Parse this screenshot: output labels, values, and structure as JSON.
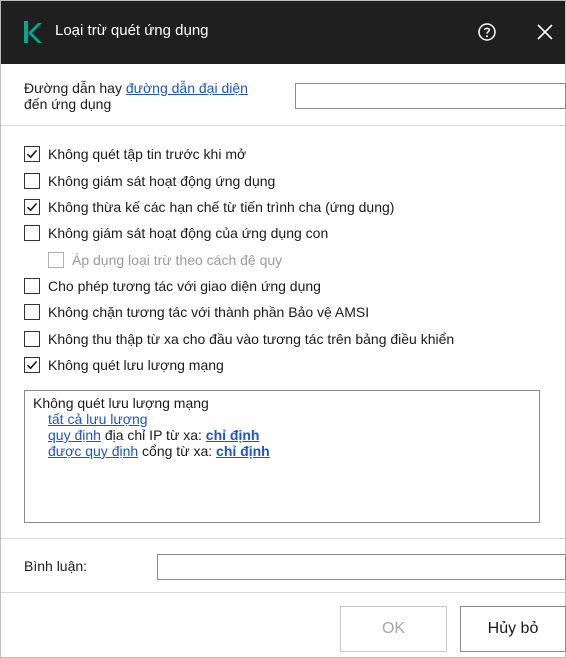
{
  "window": {
    "title": "Loại trừ quét ứng dụng"
  },
  "path": {
    "label_prefix": "Đường dẫn hay ",
    "label_link": "đường dẫn đại diện",
    "label_suffix": "đến ứng dụng",
    "value": ""
  },
  "options": [
    {
      "label": "Không quét tập tin trước khi mở",
      "checked": true,
      "enabled": true
    },
    {
      "label": "Không giám sát hoạt động ứng dụng",
      "checked": false,
      "enabled": true
    },
    {
      "label": "Không thừa kế các hạn chế từ tiến trình cha (ứng dụng)",
      "checked": true,
      "enabled": true
    },
    {
      "label": "Không giám sát hoạt động của ứng dụng con",
      "checked": false,
      "enabled": true
    },
    {
      "label": "Áp dụng loại trừ theo cách đệ quy",
      "checked": false,
      "enabled": false
    },
    {
      "label": "Cho phép tương tác với giao diện ứng dụng",
      "checked": false,
      "enabled": true
    },
    {
      "label": "Không chặn tương tác với thành phần Bảo vệ AMSI",
      "checked": false,
      "enabled": true
    },
    {
      "label": "Không thu thập từ xa cho đầu vào tương tác trên bảng điều khiển",
      "checked": false,
      "enabled": true
    },
    {
      "label": "Không quét lưu lượng mạng",
      "checked": true,
      "enabled": true
    }
  ],
  "summary": {
    "heading": "Không quét lưu lượng mạng",
    "line1_link": "tất cả lưu lượng",
    "line2_link": "quy định",
    "line2_text": " địa chỉ IP từ xa: ",
    "line2_value": "chỉ định",
    "line3_link": "được quy định",
    "line3_text": " cổng từ xa: ",
    "line3_value": "chỉ định"
  },
  "comment": {
    "label": "Bình luận:",
    "value": ""
  },
  "buttons": {
    "ok": "OK",
    "cancel": "Hủy bỏ"
  },
  "colors": {
    "titlebar": "#1f1f1f",
    "logo": "#00a88e",
    "link": "#1a56c4"
  },
  "icons": {
    "logo": "kaspersky-logo",
    "help": "help-icon",
    "close": "close-icon",
    "checkbox": "checkmark-icon"
  }
}
